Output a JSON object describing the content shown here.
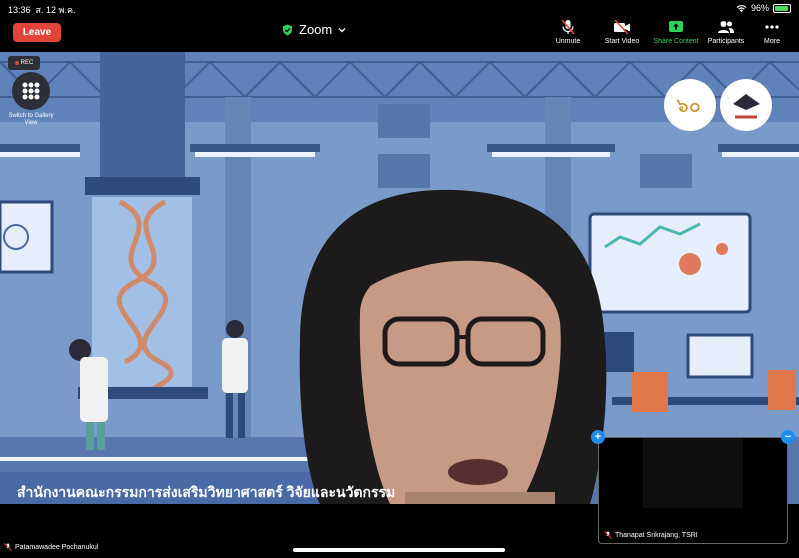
{
  "status_bar": {
    "time": "13:36",
    "date": "ส. 12 พ.ค.",
    "battery_percent_label": "96%",
    "battery_level": 0.96
  },
  "toolbar": {
    "leave_label": "Leave",
    "meeting_title": "Zoom",
    "items": [
      {
        "label": "Unmute",
        "icon": "mic-muted-icon"
      },
      {
        "label": "Start Video",
        "icon": "video-off-icon"
      },
      {
        "label": "Share Content",
        "icon": "share-screen-icon"
      },
      {
        "label": "Participants",
        "icon": "participants-icon"
      },
      {
        "label": "More",
        "icon": "more-dots-icon"
      }
    ]
  },
  "recording": {
    "label": "REC"
  },
  "gallery": {
    "label": "Switch to Gallery View"
  },
  "stage": {
    "banner_text": "สำนักงานคณะกรรมการส่งเสริมวิทยาศาสตร์ วิจัยและนวัตกรรม"
  },
  "active_speaker": {
    "name": "Patamawadee Pochanukul"
  },
  "self_view": {
    "name": "Thanapat Srikrajang, TSRI"
  },
  "colors": {
    "leave": "#e0443b",
    "share_accent": "#2fd159",
    "pip_button": "#1e8cf0",
    "lab_bg": "#6e8fbf"
  }
}
